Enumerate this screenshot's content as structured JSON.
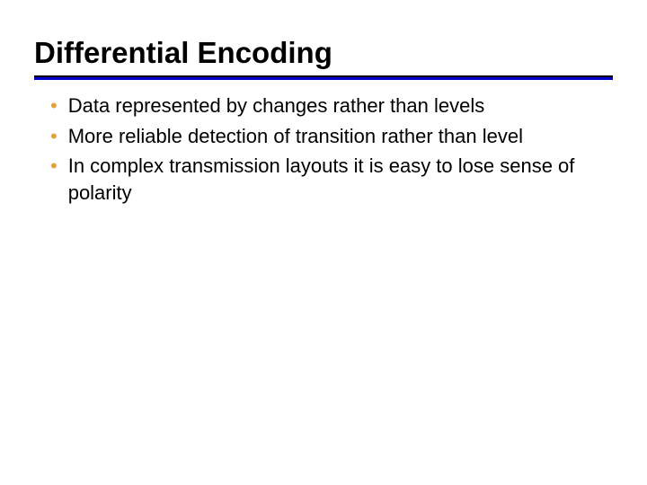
{
  "title": "Differential Encoding",
  "bullets": [
    "Data represented by changes rather than levels",
    "More reliable detection of transition rather than level",
    "In complex transmission layouts it is easy to lose sense of polarity"
  ]
}
